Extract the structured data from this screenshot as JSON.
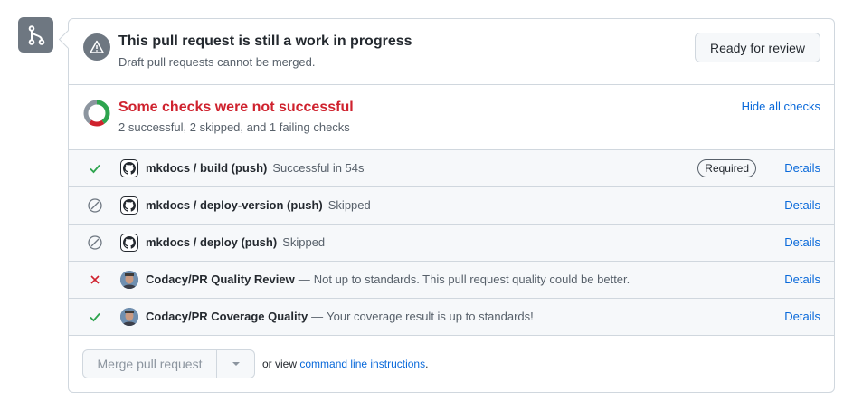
{
  "draft": {
    "title": "This pull request is still a work in progress",
    "subtitle": "Draft pull requests cannot be merged.",
    "ready_button": "Ready for review"
  },
  "checks": {
    "title": "Some checks were not successful",
    "summary": "2 successful, 2 skipped, and 1 failing checks",
    "hide_link": "Hide all checks",
    "donut": {
      "successful": 2,
      "skipped": 2,
      "failing": 1
    },
    "colors": {
      "success": "#2da44e",
      "failure": "#cf222e",
      "skipped": "#8c959f",
      "link": "#0969da"
    }
  },
  "rows": [
    {
      "status": "success",
      "status_icon": "check-icon",
      "avatar": "github-icon",
      "name": "mkdocs / build (push)",
      "dash": "",
      "description": "Successful in 54s",
      "badge": "Required",
      "details": "Details"
    },
    {
      "status": "skipped",
      "status_icon": "skipped-icon",
      "avatar": "github-icon",
      "name": "mkdocs / deploy-version (push)",
      "dash": "",
      "description": "Skipped",
      "badge": "",
      "details": "Details"
    },
    {
      "status": "skipped",
      "status_icon": "skipped-icon",
      "avatar": "github-icon",
      "name": "mkdocs / deploy (push)",
      "dash": "",
      "description": "Skipped",
      "badge": "",
      "details": "Details"
    },
    {
      "status": "failure",
      "status_icon": "x-icon",
      "avatar": "user-avatar",
      "name": "Codacy/PR Quality Review",
      "dash": "—",
      "description": "Not up to standards. This pull request quality could be better.",
      "badge": "",
      "details": "Details"
    },
    {
      "status": "success",
      "status_icon": "check-icon",
      "avatar": "user-avatar",
      "name": "Codacy/PR Coverage Quality",
      "dash": "—",
      "description": "Your coverage result is up to standards!",
      "badge": "",
      "details": "Details"
    }
  ],
  "merge": {
    "button": "Merge pull request",
    "note_prefix": "or view",
    "note_link": "command line instructions",
    "note_suffix": "."
  }
}
